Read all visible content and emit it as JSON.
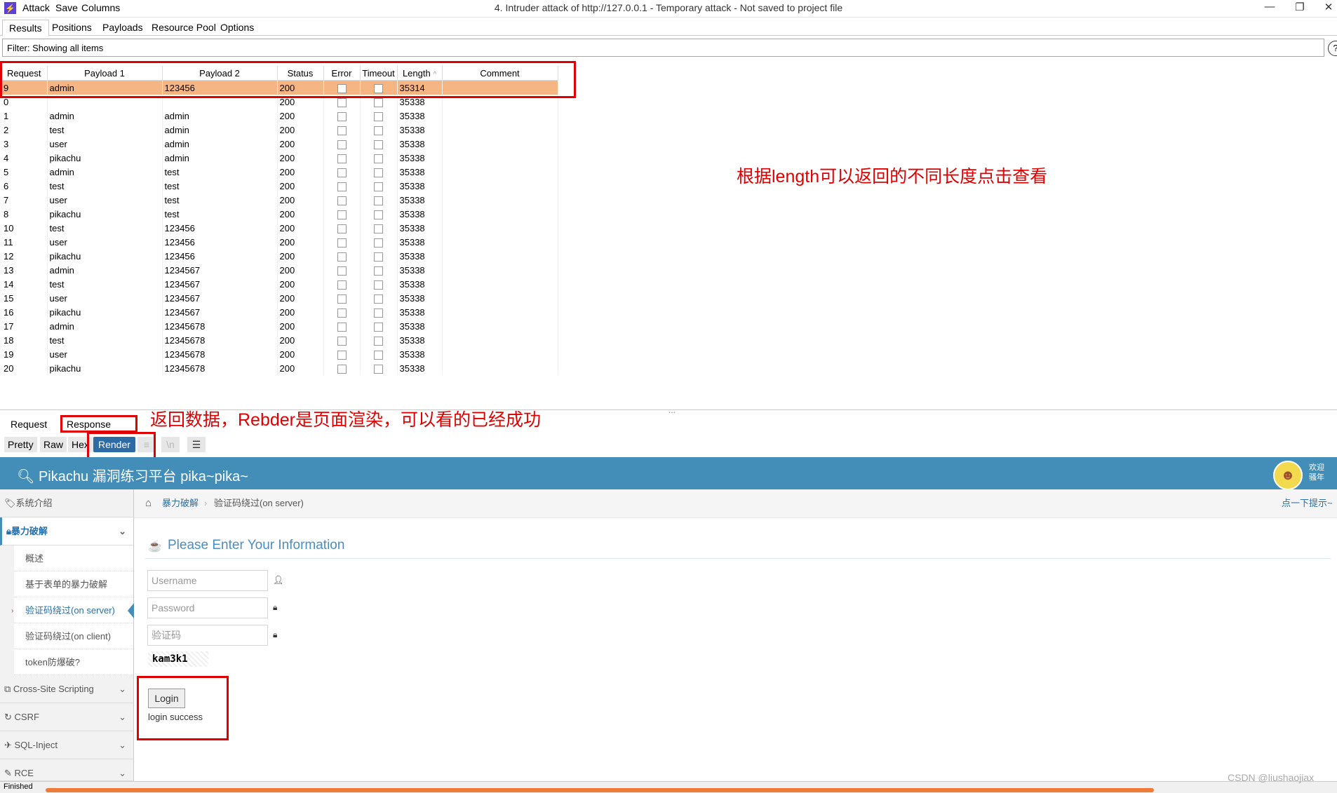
{
  "window": {
    "menu": [
      "Attack",
      "Save",
      "Columns"
    ],
    "title": "4. Intruder attack of http://127.0.0.1 - Temporary attack - Not saved to project file",
    "controls": [
      "—",
      "❐",
      "✕"
    ]
  },
  "tabs": [
    "Results",
    "Positions",
    "Payloads",
    "Resource Pool",
    "Options"
  ],
  "filter": {
    "label": "Filter: Showing all items",
    "help": "?"
  },
  "table": {
    "columns": [
      "Request",
      "Payload 1",
      "Payload 2",
      "Status",
      "Error",
      "Timeout",
      "Length",
      "Comment"
    ],
    "sort_indicator": "^",
    "rows": [
      [
        "9",
        "admin",
        "123456",
        "200",
        "35314"
      ],
      [
        "0",
        "",
        "",
        "200",
        "35338"
      ],
      [
        "1",
        "admin",
        "admin",
        "200",
        "35338"
      ],
      [
        "2",
        "test",
        "admin",
        "200",
        "35338"
      ],
      [
        "3",
        "user",
        "admin",
        "200",
        "35338"
      ],
      [
        "4",
        "pikachu",
        "admin",
        "200",
        "35338"
      ],
      [
        "5",
        "admin",
        "test",
        "200",
        "35338"
      ],
      [
        "6",
        "test",
        "test",
        "200",
        "35338"
      ],
      [
        "7",
        "user",
        "test",
        "200",
        "35338"
      ],
      [
        "8",
        "pikachu",
        "test",
        "200",
        "35338"
      ],
      [
        "10",
        "test",
        "123456",
        "200",
        "35338"
      ],
      [
        "11",
        "user",
        "123456",
        "200",
        "35338"
      ],
      [
        "12",
        "pikachu",
        "123456",
        "200",
        "35338"
      ],
      [
        "13",
        "admin",
        "1234567",
        "200",
        "35338"
      ],
      [
        "14",
        "test",
        "1234567",
        "200",
        "35338"
      ],
      [
        "15",
        "user",
        "1234567",
        "200",
        "35338"
      ],
      [
        "16",
        "pikachu",
        "1234567",
        "200",
        "35338"
      ],
      [
        "17",
        "admin",
        "12345678",
        "200",
        "35338"
      ],
      [
        "18",
        "test",
        "12345678",
        "200",
        "35338"
      ],
      [
        "19",
        "user",
        "12345678",
        "200",
        "35338"
      ],
      [
        "20",
        "pikachu",
        "12345678",
        "200",
        "35338"
      ]
    ]
  },
  "annotations": {
    "length_note": "根据length可以返回的不同长度点击查看",
    "render_note": "返回数据，Rebder是页面渲染，可以看的已经成功"
  },
  "splitter": "...",
  "editor": {
    "tabs": [
      "Request",
      "Response"
    ],
    "views": [
      "Pretty",
      "Raw",
      "Hex",
      "Render"
    ],
    "icon_buttons": [
      "≡",
      "\\n",
      "☰"
    ]
  },
  "pikachu": {
    "title": "Pikachu 漏洞练习平台 pika~pika~",
    "welcome": [
      "欢迎",
      "骚年"
    ],
    "avatar": "☻",
    "sidebar": {
      "intro": "系统介绍",
      "brute": "暴力破解",
      "brute_sub": [
        "概述",
        "基于表单的暴力破解",
        "验证码绕过(on server)",
        "验证码绕过(on client)",
        "token防爆破?"
      ],
      "sections": [
        "Cross-Site Scripting",
        "CSRF",
        "SQL-Inject",
        "RCE"
      ]
    },
    "breadcrumb": {
      "home": "暴力破解",
      "sep": "›",
      "current": "验证码绕过(on server)",
      "hint": "点一下提示~"
    },
    "form": {
      "heading": "Please Enter Your Information",
      "username_placeholder": "Username",
      "password_placeholder": "Password",
      "captcha_placeholder": "验证码",
      "captcha": "kam3k1",
      "login": "Login",
      "result": "login success"
    }
  },
  "status": {
    "text": "Finished",
    "watermark": "CSDN @liushaojiax"
  },
  "colors": {
    "selected_row": "#f5b683",
    "annotation": "#e00000",
    "pikachu_header": "#438eb9",
    "progress": "#f07a38"
  }
}
